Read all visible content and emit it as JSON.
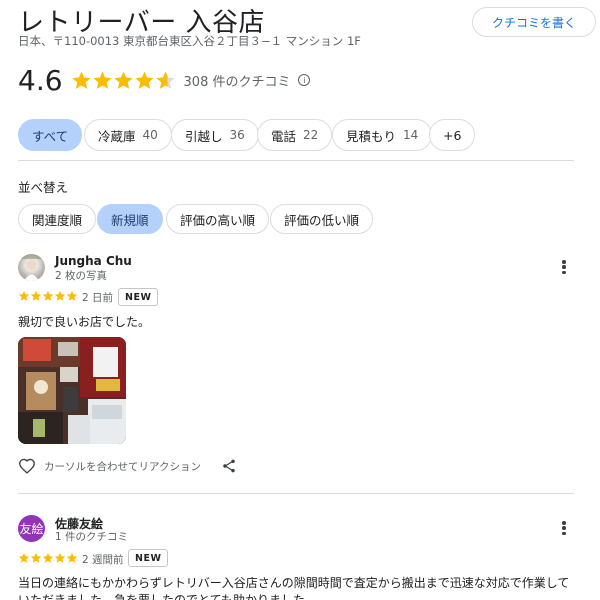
{
  "place": {
    "name": "レトリーバー 入谷店",
    "address": "日本、〒110-0013 東京都台東区入谷２丁目３−１ マンション 1F",
    "write_review_label": "クチコミを書く"
  },
  "rating": {
    "value": "4.6",
    "stars_value": 4.6,
    "review_count_label": "308 件のクチコミ",
    "info_icon": "info-icon"
  },
  "filters": [
    {
      "label": "すべて",
      "count": "",
      "active": true
    },
    {
      "label": "冷蔵庫",
      "count": "40",
      "active": false
    },
    {
      "label": "引越し",
      "count": "36",
      "active": false
    },
    {
      "label": "電話",
      "count": "22",
      "active": false
    },
    {
      "label": "見積もり",
      "count": "14",
      "active": false
    },
    {
      "label": "+6",
      "count": "",
      "active": false
    }
  ],
  "sort": {
    "label": "並べ替え",
    "options": [
      {
        "label": "関連度順",
        "active": false
      },
      {
        "label": "新規順",
        "active": true
      },
      {
        "label": "評価の高い順",
        "active": false
      },
      {
        "label": "評価の低い順",
        "active": false
      }
    ]
  },
  "reviews": [
    {
      "name": "Jungha Chu",
      "meta": "2 枚の写真",
      "stars": 5,
      "time": "2 日前",
      "badge": "NEW",
      "text": "親切で良いお店でした。",
      "reaction_label": "カーソルを合わせてリアクション"
    },
    {
      "name": "佐藤友絵",
      "avatar_letter": "友絵",
      "meta": "1 件のクチコミ",
      "stars": 5,
      "time": "2 週間前",
      "badge": "NEW",
      "text": "当日の連絡にもかかわらずレトリバー入谷店さんの隙間時間で査定から搬出まで迅速な対応で作業していただきました。急を要したのでとても助かりました。"
    }
  ],
  "colors": {
    "star": "#fbbc04",
    "accent": "#1a73e8",
    "chip_active": "#b3d1fb",
    "avatar_purple": "#9334b6"
  }
}
